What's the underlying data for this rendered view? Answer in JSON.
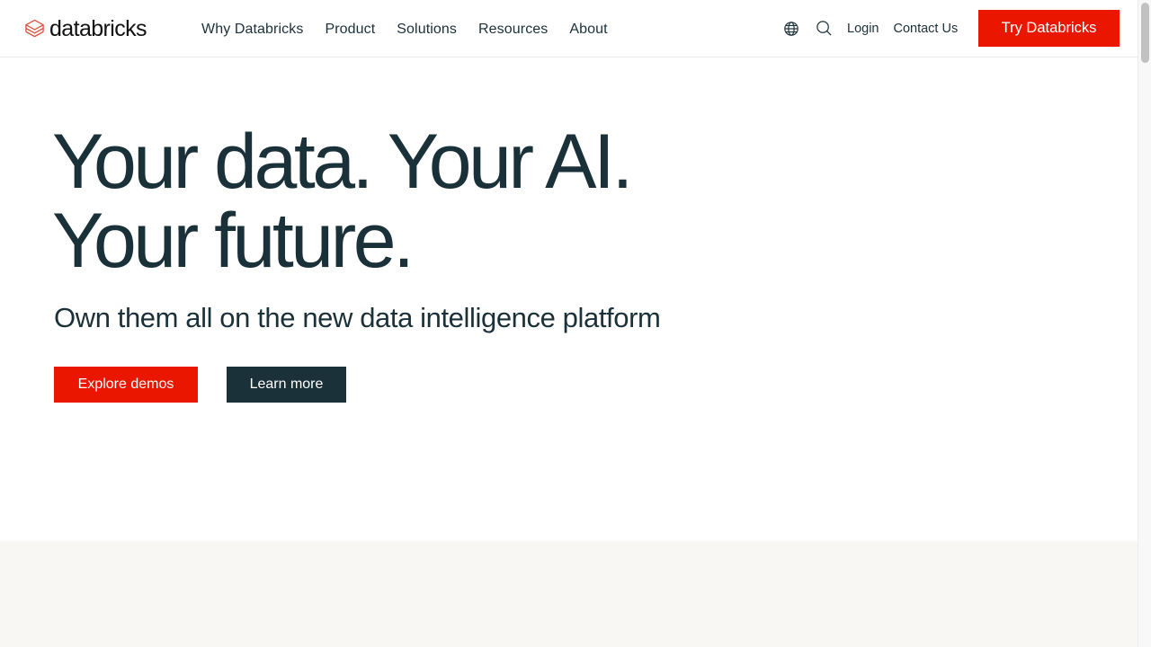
{
  "header": {
    "logo_text": "databricks",
    "nav": [
      {
        "label": "Why Databricks"
      },
      {
        "label": "Product"
      },
      {
        "label": "Solutions"
      },
      {
        "label": "Resources"
      },
      {
        "label": "About"
      }
    ],
    "icons": {
      "globe": "globe-icon",
      "search": "search-icon"
    },
    "login_label": "Login",
    "contact_label": "Contact Us",
    "cta_label": "Try Databricks"
  },
  "hero": {
    "title_line1": "Your data. Your AI.",
    "title_line2": "Your future.",
    "subtitle": "Own them all on the new data intelligence platform",
    "primary_button": "Explore demos",
    "secondary_button": "Learn more"
  },
  "colors": {
    "brand_red": "#eb1600",
    "navy": "#1b3139",
    "band_bg": "#f9f7f4",
    "logo_mark": "#e0523f"
  }
}
